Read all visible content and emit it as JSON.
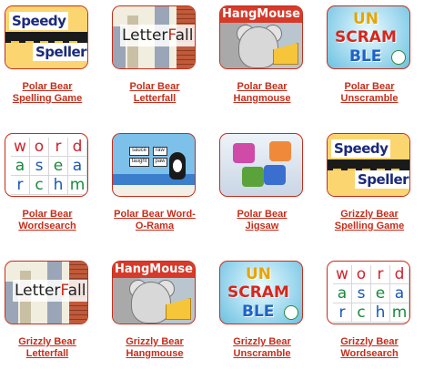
{
  "games": [
    {
      "type": "speedy",
      "line1": "Polar Bear",
      "line2": "Spelling Game",
      "logo": [
        "Speedy",
        "Speller"
      ]
    },
    {
      "type": "letterfall",
      "line1": "Polar Bear",
      "line2": "Letterfall",
      "logo": "LetterFall"
    },
    {
      "type": "hangmouse",
      "line1": "Polar Bear",
      "line2": "Hangmouse",
      "logo": "HangMouse"
    },
    {
      "type": "unscramble",
      "line1": "Polar Bear",
      "line2": "Unscramble",
      "logo": [
        "UN",
        "SCRAM",
        "BLE"
      ]
    },
    {
      "type": "wordsearch",
      "line1": "Polar Bear",
      "line2": "Wordsearch",
      "letters": [
        [
          "w",
          "o",
          "r",
          "d"
        ],
        [
          "a",
          "s",
          "e",
          "a"
        ],
        [
          "r",
          "c",
          "h",
          "m"
        ]
      ]
    },
    {
      "type": "wordorama",
      "line1": "Polar Bear Word-",
      "line2": "O-Rama",
      "boxes": [
        "sauce",
        "raw",
        "taught",
        "paw"
      ]
    },
    {
      "type": "jigsaw",
      "line1": "Polar Bear",
      "line2": "Jigsaw"
    },
    {
      "type": "speedy",
      "line1": "Grizzly Bear",
      "line2": "Spelling Game",
      "logo": [
        "Speedy",
        "Speller"
      ]
    },
    {
      "type": "letterfall",
      "line1": "Grizzly Bear",
      "line2": "Letterfall",
      "logo": "LetterFall"
    },
    {
      "type": "hangmouse",
      "line1": "Grizzly Bear",
      "line2": "Hangmouse",
      "logo": "HangMouse"
    },
    {
      "type": "unscramble",
      "line1": "Grizzly Bear",
      "line2": "Unscramble",
      "logo": [
        "UN",
        "SCRAM",
        "BLE"
      ]
    },
    {
      "type": "wordsearch",
      "line1": "Grizzly Bear",
      "line2": "Wordsearch",
      "letters": [
        [
          "w",
          "o",
          "r",
          "d"
        ],
        [
          "a",
          "s",
          "e",
          "a"
        ],
        [
          "r",
          "c",
          "h",
          "m"
        ]
      ]
    }
  ],
  "colors": {
    "link": "#c62d1a",
    "border": "#c62d1a"
  }
}
